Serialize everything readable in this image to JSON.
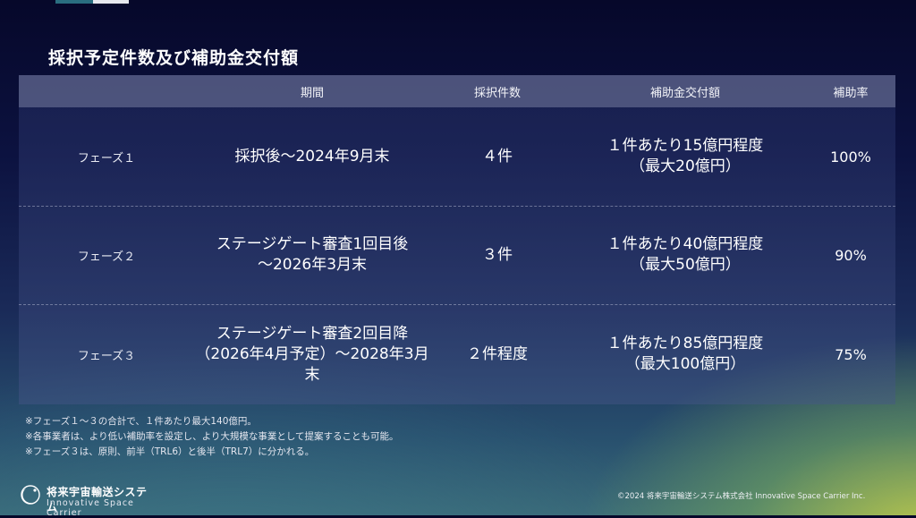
{
  "page_title": "採択予定件数及び補助金交付額",
  "table": {
    "headers": {
      "phase": "",
      "period": "期間",
      "count": "採択件数",
      "amount": "補助金交付額",
      "rate": "補助率"
    },
    "rows": [
      {
        "phase": "フェーズ１",
        "period": [
          "採択後～2024年9月末"
        ],
        "count": "４件",
        "amount": [
          "１件あたり15億円程度",
          "（最大20億円）"
        ],
        "rate": "100%"
      },
      {
        "phase": "フェーズ２",
        "period": [
          "ステージゲート審査1回目後",
          "～2026年3月末"
        ],
        "count": "３件",
        "amount": [
          "１件あたり40億円程度",
          "（最大50億円）"
        ],
        "rate": "90%"
      },
      {
        "phase": "フェーズ３",
        "period": [
          "ステージゲート審査2回目降",
          "（2026年4月予定）～2028年3月末"
        ],
        "count": "２件程度",
        "amount": [
          "１件あたり85億円程度",
          "（最大100億円）"
        ],
        "rate": "75%"
      }
    ]
  },
  "notes": [
    "※フェーズ１～３の合計で、１件あたり最大140億円。",
    "※各事業者は、より低い補助率を設定し、より大規模な事業として提案することも可能。",
    "※フェーズ３は、原則、前半（TRL6）と後半（TRL7）に分かれる。"
  ],
  "footer": {
    "logo_jp": "将来宇宙輸送システム",
    "logo_en": "Innovative Space Carrier",
    "copyright": "©2024 将来宇宙輸送システム株式会社 Innovative Space Carrier Inc."
  }
}
